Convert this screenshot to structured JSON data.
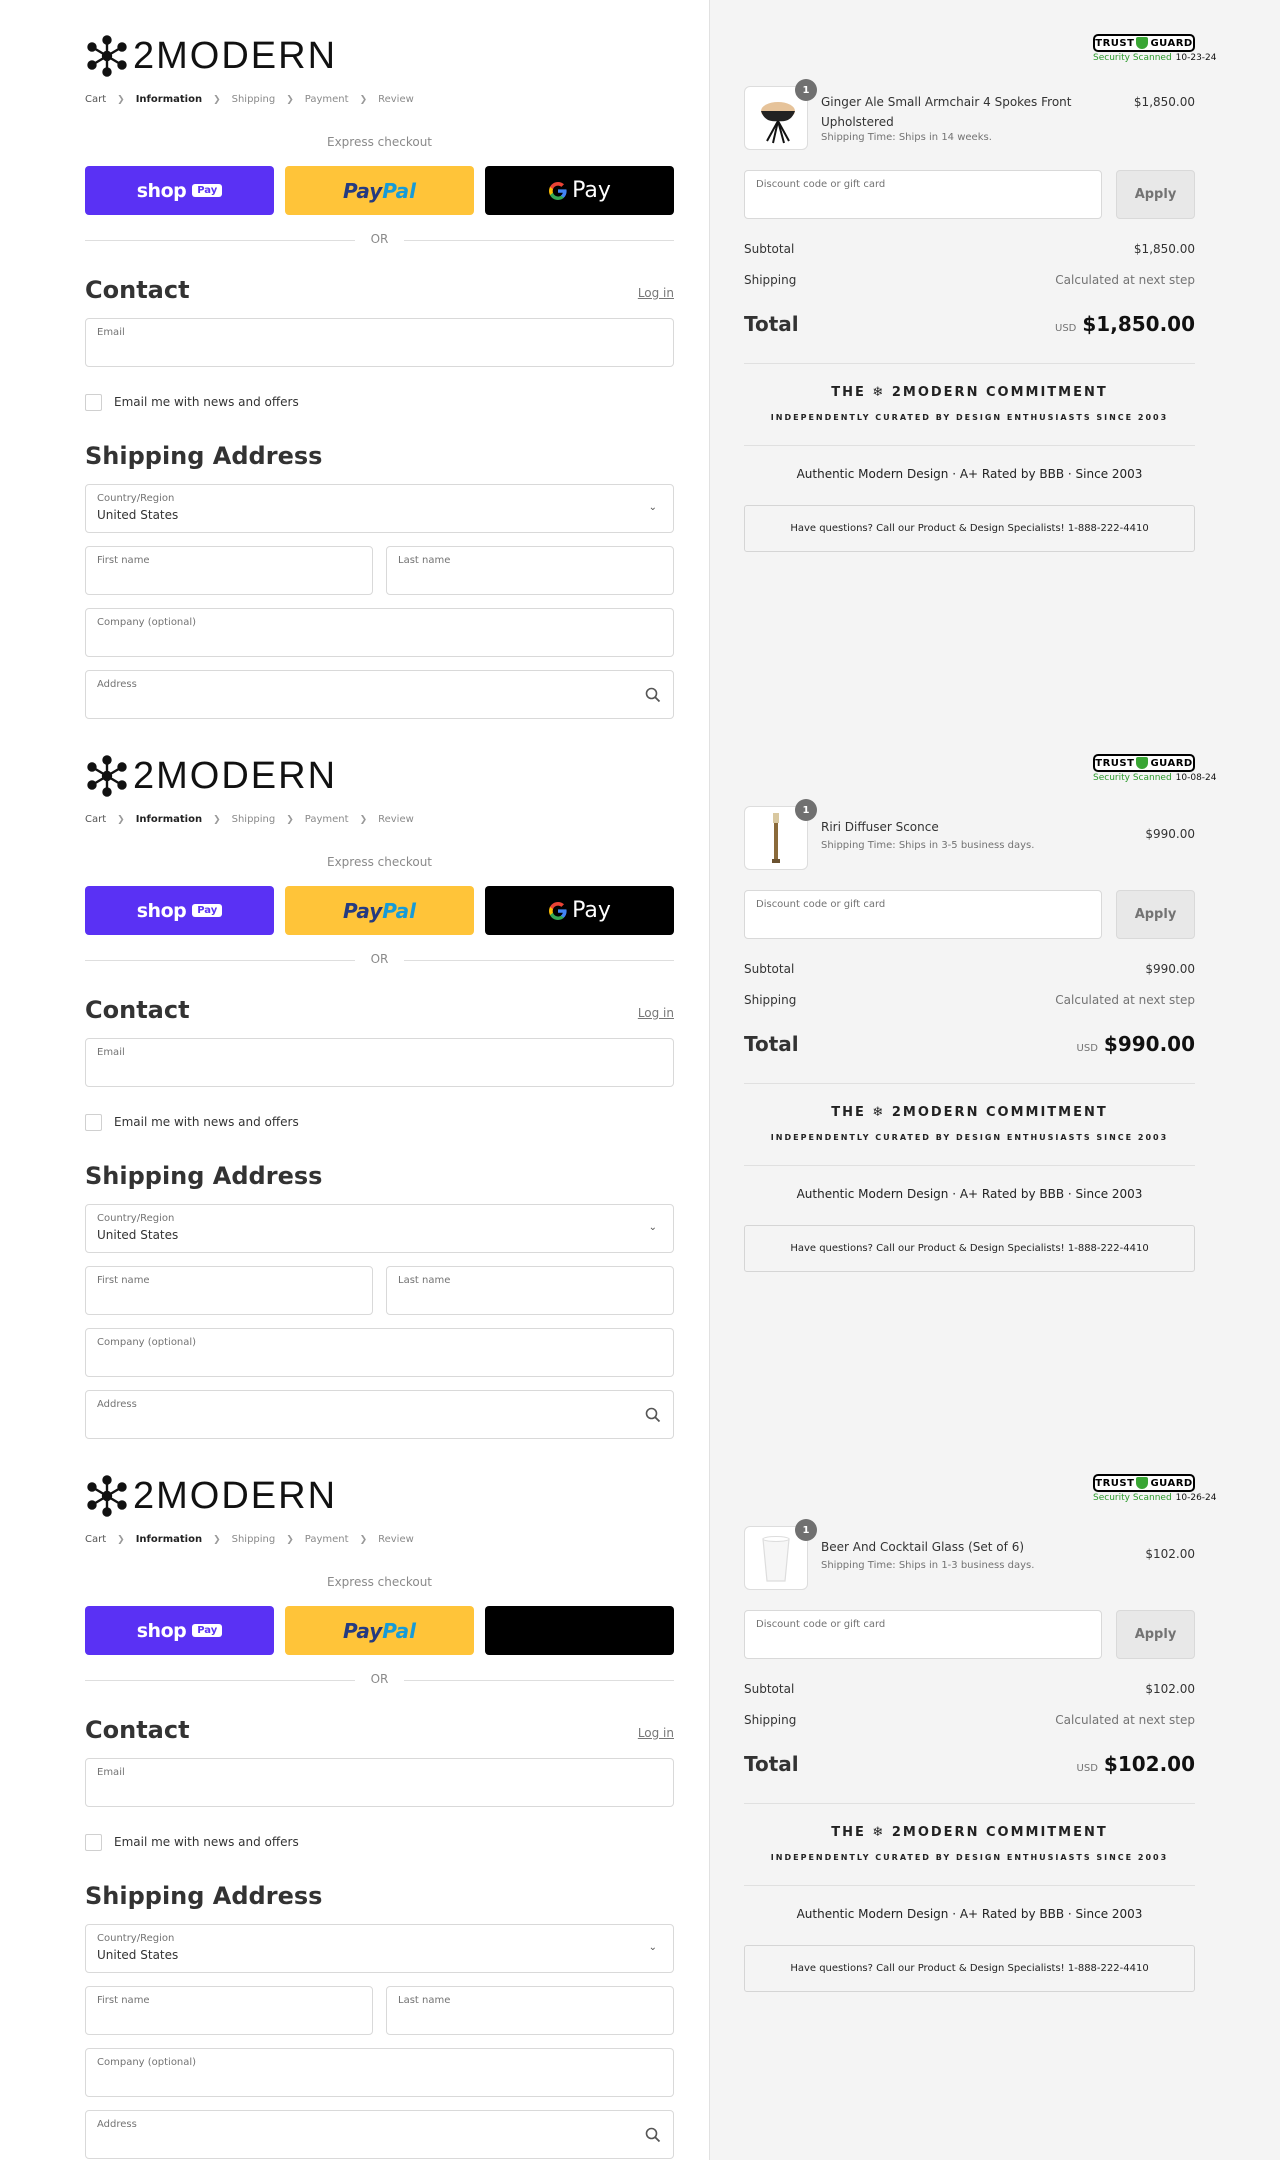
{
  "brand": {
    "name": "2MODERN"
  },
  "breadcrumb": [
    "Cart",
    "Information",
    "Shipping",
    "Payment",
    "Review"
  ],
  "express_checkout": "Express checkout",
  "pay_buttons": {
    "shop": "shop",
    "shop_badge": "Pay",
    "paypal_1": "Pay",
    "paypal_2": "Pal",
    "gpay": "Pay"
  },
  "or_text": "OR",
  "contact": {
    "heading": "Contact",
    "login": "Log in",
    "email_label": "Email",
    "newsletter": "Email me with news and offers"
  },
  "shipping": {
    "heading": "Shipping Address",
    "country_label": "Country/Region",
    "country_value": "United States",
    "first_name": "First name",
    "last_name": "Last name",
    "company": "Company (optional)",
    "address": "Address"
  },
  "trust": {
    "title_a": "TRUST",
    "title_b": "GUARD",
    "scanned": "Security Scanned"
  },
  "discount": {
    "placeholder": "Discount code or gift card",
    "apply": "Apply"
  },
  "summary_labels": {
    "subtotal": "Subtotal",
    "shipping": "Shipping",
    "shipping_value": "Calculated at next step",
    "total": "Total",
    "currency": "USD"
  },
  "commitment": {
    "title": "THE ❄ 2MODERN COMMITMENT",
    "subtitle": "INDEPENDENTLY CURATED BY DESIGN ENTHUSIASTS SINCE 2003"
  },
  "authentic": "Authentic Modern Design · A+ Rated by BBB · Since 2003",
  "questions": "Have questions? Call our Product & Design Specialists! 1-888-222-4410",
  "orders": [
    {
      "trust_date": "10-23-24",
      "qty": "1",
      "item": "Ginger Ale Small Armchair 4 Spokes Front Upholstered",
      "ship_time": "Shipping Time: Ships in 14 weeks.",
      "price": "$1,850.00",
      "subtotal": "$1,850.00",
      "total": "$1,850.00"
    },
    {
      "trust_date": "10-08-24",
      "qty": "1",
      "item": "Riri Diffuser Sconce",
      "ship_time": "Shipping Time: Ships in 3-5 business days.",
      "price": "$990.00",
      "subtotal": "$990.00",
      "total": "$990.00"
    },
    {
      "trust_date": "10-26-24",
      "qty": "1",
      "item": "Beer And Cocktail Glass (Set of 6)",
      "ship_time": "Shipping Time: Ships in 1-3 business days.",
      "price": "$102.00",
      "subtotal": "$102.00",
      "total": "$102.00"
    }
  ]
}
